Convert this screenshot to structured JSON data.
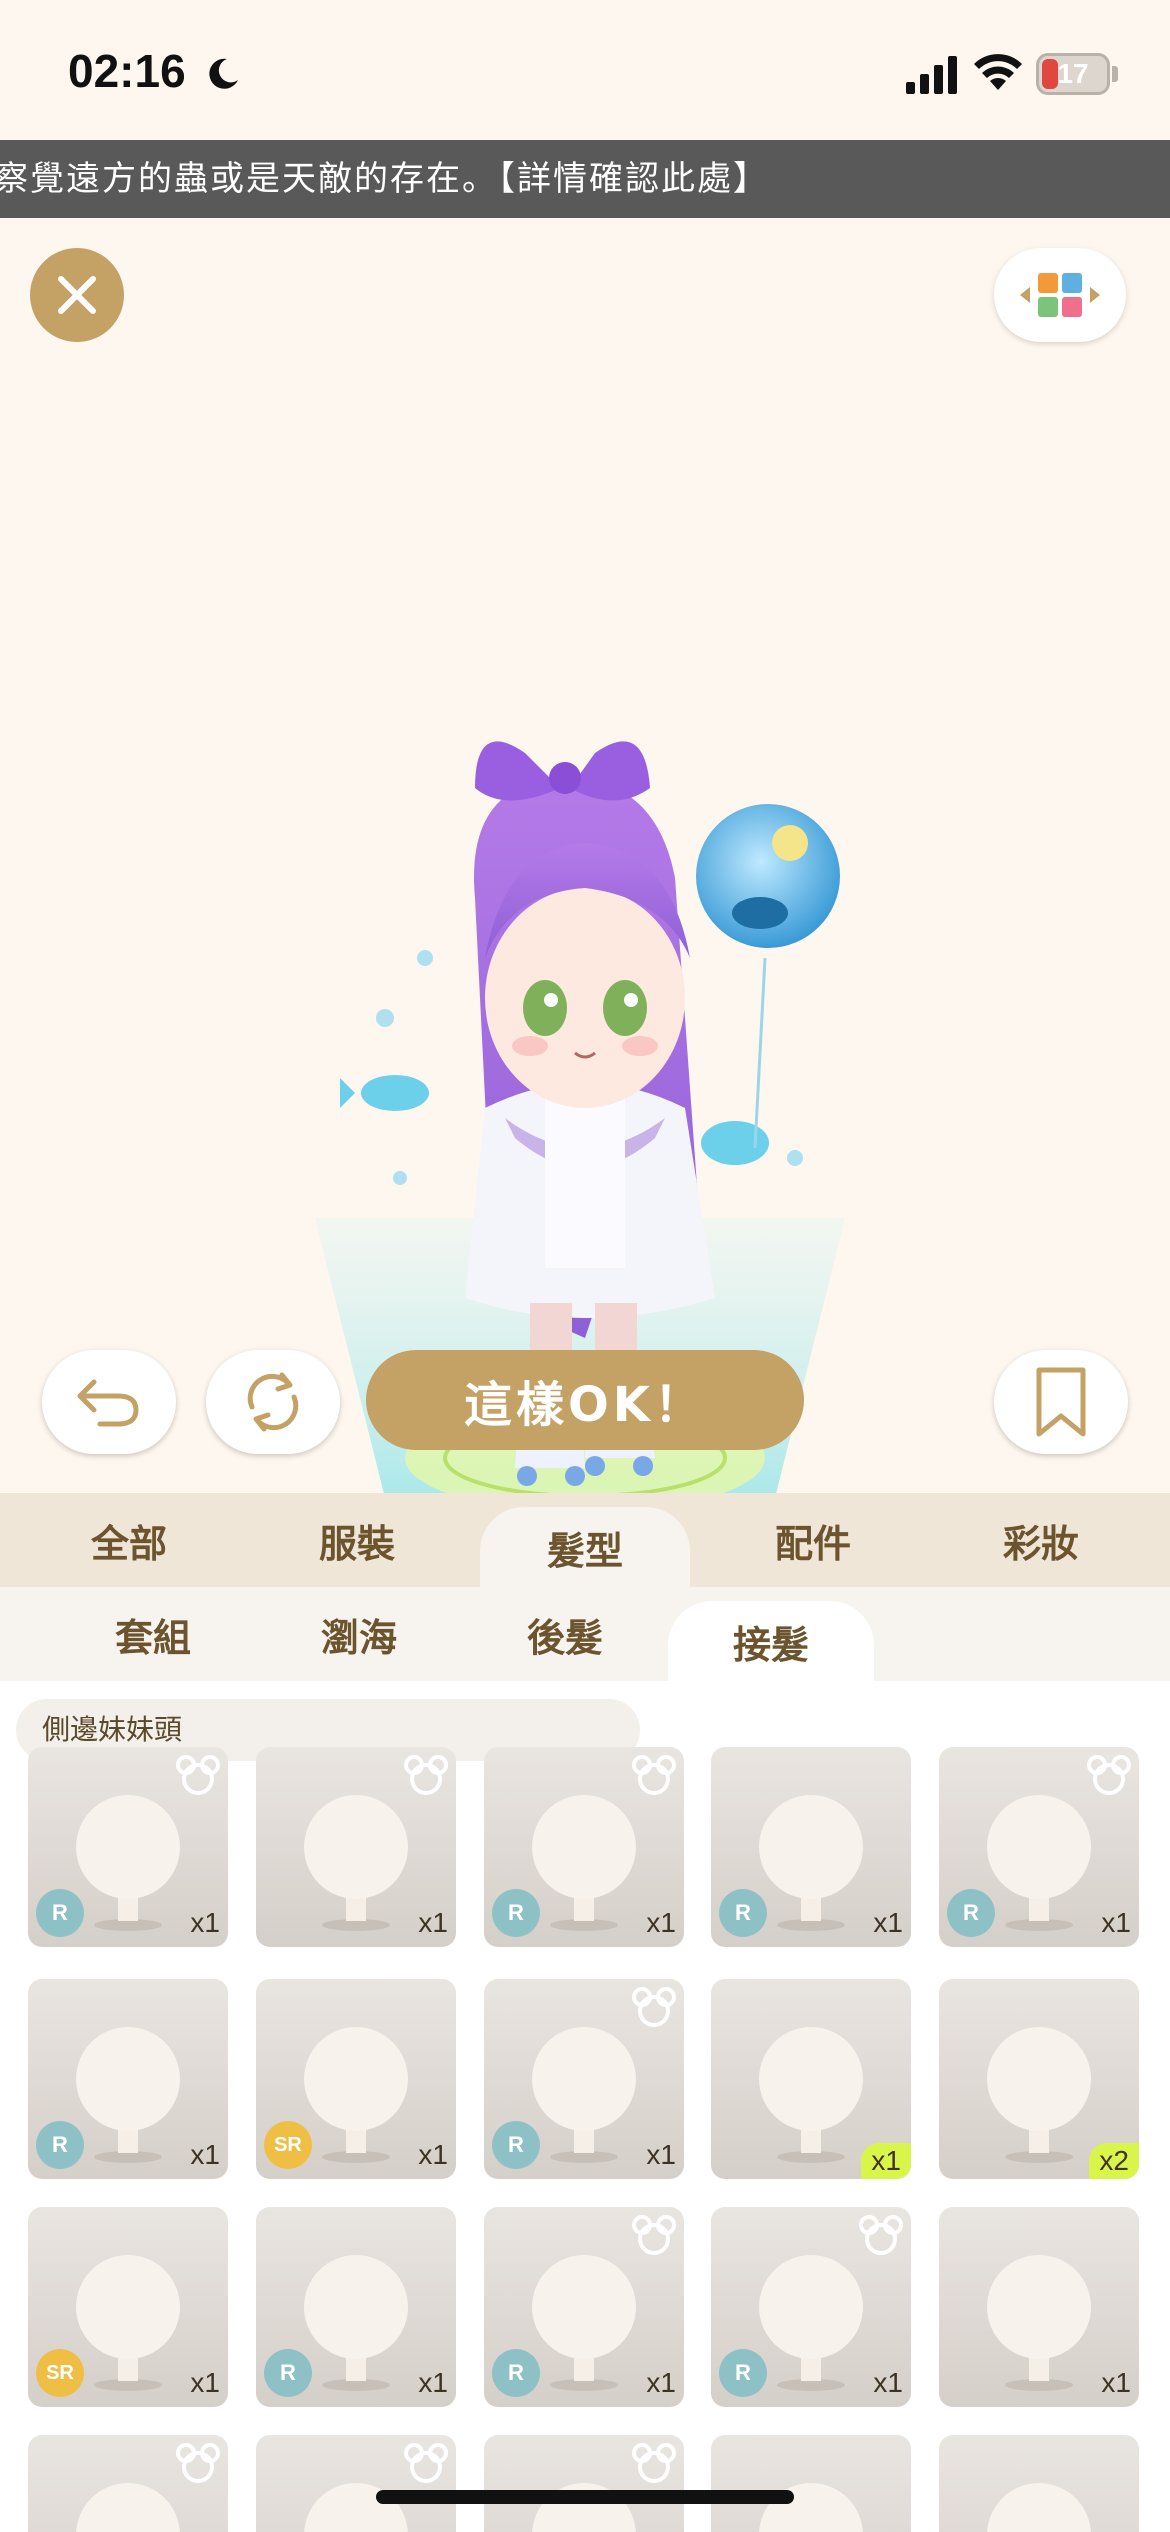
{
  "status": {
    "time": "02:16",
    "battery": "17"
  },
  "marquee": {
    "text": "察覺遠方的蟲或是天敵的存在。【詳情確認此處】"
  },
  "actions": {
    "ok_label": "這樣OK！"
  },
  "categories": [
    {
      "label": "全部"
    },
    {
      "label": "服裝"
    },
    {
      "label": "髮型",
      "active": true
    },
    {
      "label": "配件"
    },
    {
      "label": "彩妝"
    }
  ],
  "subcategories": [
    {
      "label": "套組"
    },
    {
      "label": "瀏海"
    },
    {
      "label": "後髮"
    },
    {
      "label": "接髮",
      "active": true
    }
  ],
  "section": {
    "label": "側邊妹妹頭"
  },
  "items": [
    {
      "rarity": "R",
      "qty": "x1",
      "bear": true
    },
    {
      "rarity": "",
      "qty": "x1",
      "bear": true
    },
    {
      "rarity": "R",
      "qty": "x1",
      "bear": true
    },
    {
      "rarity": "R",
      "qty": "x1",
      "bear": false
    },
    {
      "rarity": "R",
      "qty": "x1",
      "bear": true
    },
    {
      "rarity": "R",
      "qty": "x1",
      "bear": false
    },
    {
      "rarity": "SR",
      "qty": "x1",
      "bear": false
    },
    {
      "rarity": "R",
      "qty": "x1",
      "bear": true
    },
    {
      "rarity": "",
      "qty": "x1",
      "bear": false,
      "new": true
    },
    {
      "rarity": "",
      "qty": "x2",
      "bear": false,
      "new": true
    },
    {
      "rarity": "SR",
      "qty": "x1",
      "bear": false
    },
    {
      "rarity": "R",
      "qty": "x1",
      "bear": false
    },
    {
      "rarity": "R",
      "qty": "x1",
      "bear": true
    },
    {
      "rarity": "R",
      "qty": "x1",
      "bear": true
    },
    {
      "rarity": "",
      "qty": "x1",
      "bear": false
    },
    {
      "rarity": "",
      "qty": "",
      "bear": true
    },
    {
      "rarity": "",
      "qty": "",
      "bear": true
    },
    {
      "rarity": "",
      "qty": "",
      "bear": true
    },
    {
      "rarity": "",
      "qty": "",
      "bear": false
    },
    {
      "rarity": "",
      "qty": "",
      "bear": false
    }
  ]
}
